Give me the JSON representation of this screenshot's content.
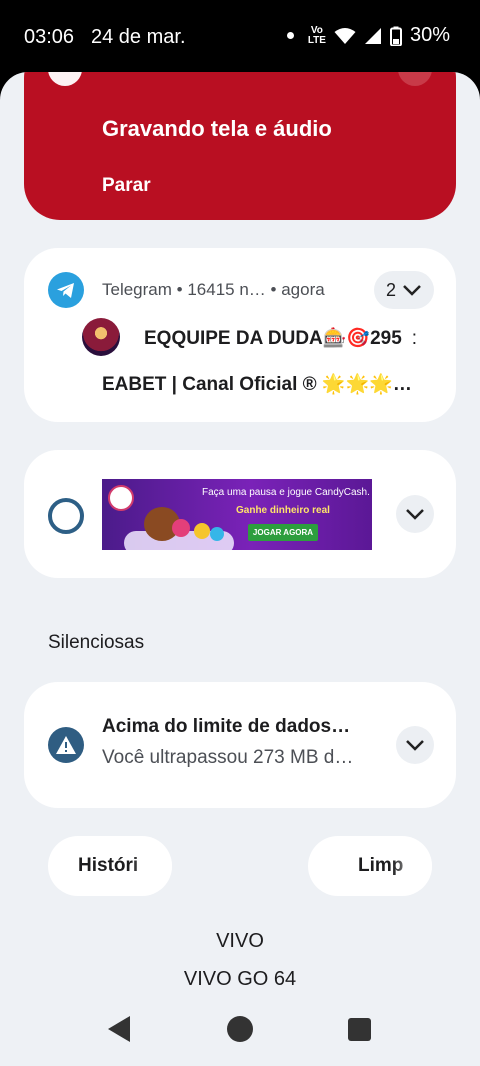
{
  "status_bar": {
    "time": "03:06",
    "date": "24 de mar.",
    "network_label_top": "Vo",
    "network_label_bottom": "LTE",
    "battery": "30%",
    "icons": [
      "notification-dot-icon",
      "volte-icon",
      "wifi-icon",
      "signal-icon",
      "battery-icon"
    ]
  },
  "recording": {
    "title": "Gravando tela e áudio",
    "stop_label": "Parar",
    "color": "#b90f22"
  },
  "telegram": {
    "app": "Telegram",
    "detail": "16415 n…",
    "time": "agora",
    "count": "2",
    "message_line1": "EQQUIPE DA DUDA🎰🎯295",
    "message_line1_tail": ":",
    "message_line2": "EABET | Canal Oficial ® 🌟🌟🌟…",
    "accent": "#2aa0de"
  },
  "ad": {
    "headline": "Faça uma pausa e jogue CandyCash.",
    "subline": "Ganhe dinheiro real",
    "cta": "JOGAR AGORA"
  },
  "silent_section": {
    "title": "Silenciosas"
  },
  "data_alert": {
    "title": "Acima do limite de dados…",
    "body": "Você ultrapassou 273 MB d…"
  },
  "actions": {
    "history": "Históri",
    "clear": "Limp"
  },
  "carrier": {
    "line1": "VIVO",
    "line2": "VIVO GO 64"
  }
}
